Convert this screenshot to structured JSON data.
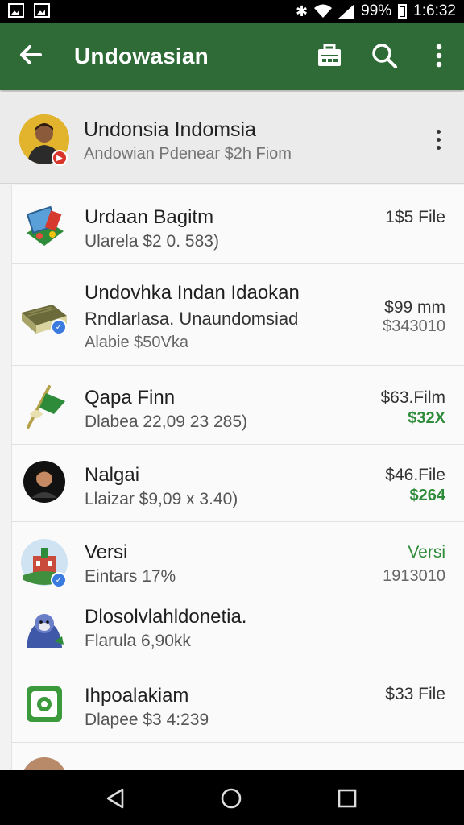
{
  "status_bar": {
    "battery": "99%",
    "time": "1:6:32"
  },
  "app_bar": {
    "title": "Undowasian"
  },
  "account": {
    "name": "Undonsia Indomsia",
    "subtitle": "Andowian Pdenear $2h Fiom"
  },
  "items": [
    {
      "title": "Urdaan Bagitm",
      "sub": "Ularela $2 0. 583)",
      "right_top": "1$5 File"
    },
    {
      "title": "Undovhka Indan Idaokan",
      "sub": "Rndlarlasa. Unaundomsiad",
      "extra": "Alabie $50Vka",
      "right_top": "$99 mm",
      "right_bottom": "$343010"
    },
    {
      "title": "Qapa Finn",
      "sub": "Dlabea 22,09 23 285)",
      "right_top": "$63.Film",
      "right_bottom": "$32X"
    },
    {
      "title": "Nalgai",
      "sub": "Llaizar $9,09 x 3.40)",
      "right_top": "$46.File",
      "right_bottom": "$264"
    },
    {
      "title": "Versi",
      "sub": "Eintars 17%",
      "right_top": "Versi",
      "right_bottom": "1913010"
    },
    {
      "title": "Dlosolvlahldonetia.",
      "sub": "Flarula 6,90kk"
    },
    {
      "title": "Ihpoalakiam",
      "sub": "Dlapee $3 4:239",
      "right_top": "$33 File"
    }
  ],
  "colors": {
    "app_bar": "#2f6b37",
    "accent_green": "#2e8b3a",
    "badge_red": "#d9342a",
    "badge_blue": "#3b7be0"
  },
  "icons": {
    "app_bar": [
      "arrow-back-icon",
      "briefcase-icon",
      "search-icon",
      "more-vert-icon"
    ],
    "nav_bar": [
      "nav-back-icon",
      "nav-home-icon",
      "nav-recent-icon"
    ]
  }
}
